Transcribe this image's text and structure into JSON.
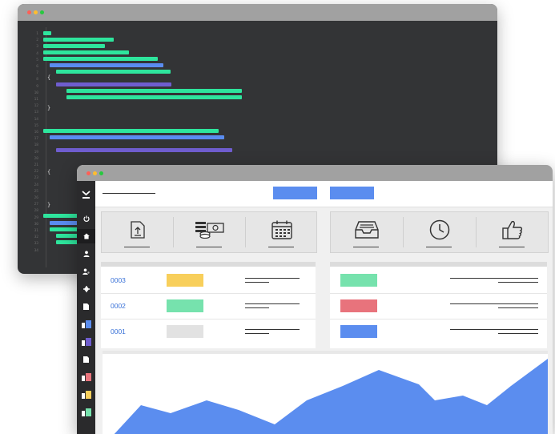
{
  "code_editor": {
    "line_numbers": [
      "1",
      "2",
      "3",
      "4",
      "5",
      "6",
      "7",
      "8",
      "9",
      "10",
      "11",
      "12",
      "13",
      "14",
      "15",
      "16",
      "17",
      "18",
      "19",
      "20",
      "21",
      "22",
      "23",
      "24",
      "25",
      "26",
      "27",
      "28",
      "29",
      "30",
      "31",
      "32",
      "33",
      "34"
    ],
    "brace_open": "{",
    "brace_close": "}"
  },
  "dashboard": {
    "table_left": {
      "rows": [
        {
          "id": "0003",
          "swatch_color": "#f8cf5b"
        },
        {
          "id": "0002",
          "swatch_color": "#76e2ad"
        },
        {
          "id": "0001",
          "swatch_color": "#e2e2e2"
        }
      ]
    },
    "table_right": {
      "swatch_colors": [
        "#76e2ad",
        "#e8737c",
        "#5b8def"
      ]
    },
    "icons_left": [
      "upload-document-icon",
      "money-coins-icon",
      "calendar-icon"
    ],
    "icons_right": [
      "inbox-tray-icon",
      "clock-icon",
      "thumbs-up-icon"
    ],
    "sidebar_icons": [
      "logo-icon",
      "power-icon",
      "home-icon",
      "user-icon",
      "user-star-icon",
      "gear-icon",
      "document-icon",
      "user-badge-icon",
      "user-badge-icon",
      "document-icon",
      "user-badge-icon",
      "user-badge-icon",
      "user-badge-icon"
    ],
    "colors": {
      "accent_blue": "#5b8def",
      "code_green": "#2ee59d",
      "code_blue": "#5a8cf0",
      "code_purple": "#6f5dcf"
    }
  }
}
